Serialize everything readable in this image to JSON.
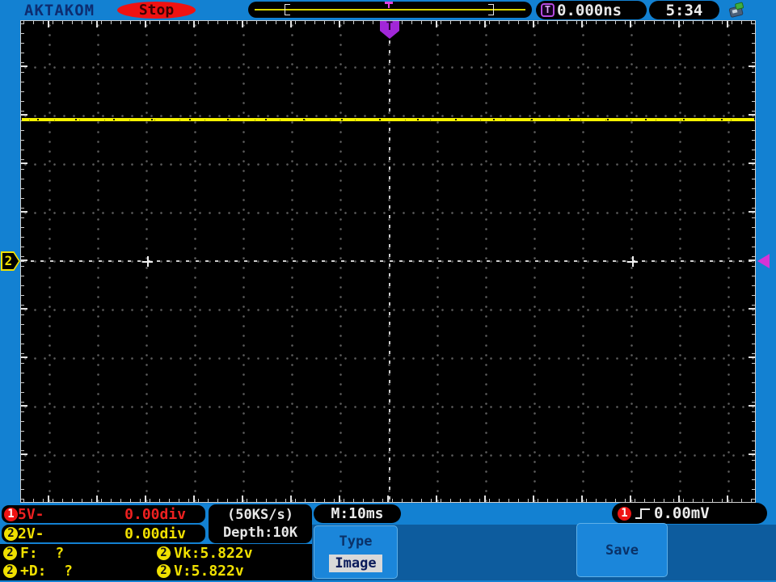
{
  "colors": {
    "frame_blue": "#1381d2",
    "menu_blue": "#0d5c9e",
    "button_blue": "#1b86da",
    "ch1_red": "#ee1414",
    "ch2_yellow": "#f0e000",
    "trace_yellow": "#f6f200",
    "trigger_purple": "#a127d8",
    "stop_red": "#ef1212",
    "navy_text": "#0d2d70"
  },
  "top_bar": {
    "brand": "AKTAKOM",
    "run_state": "Stop",
    "trigger_badge": "T",
    "trigger_offset": "0.000ns",
    "clock": "5:34"
  },
  "graticule": {
    "trigger_marker": "T",
    "channel2_marker": "2"
  },
  "channels": [
    {
      "id": "1",
      "scale": "5V-",
      "position": "0.00div"
    },
    {
      "id": "2",
      "scale": "2V-",
      "position": "0.00div"
    }
  ],
  "acquisition": {
    "sample_rate": "(50KS/s)",
    "depth": "Depth:10K",
    "timebase": "M:10ms"
  },
  "trigger": {
    "source": "1",
    "level": "0.00mV"
  },
  "measurements": [
    {
      "channel": "2",
      "text": "F:  ?"
    },
    {
      "channel": "2",
      "text": "Vk:5.822v"
    },
    {
      "channel": "2",
      "text": "+D:  ?"
    },
    {
      "channel": "2",
      "text": "V:5.822v"
    }
  ],
  "menu": {
    "type_label": "Type",
    "type_value": "Image",
    "save_label": "Save"
  }
}
